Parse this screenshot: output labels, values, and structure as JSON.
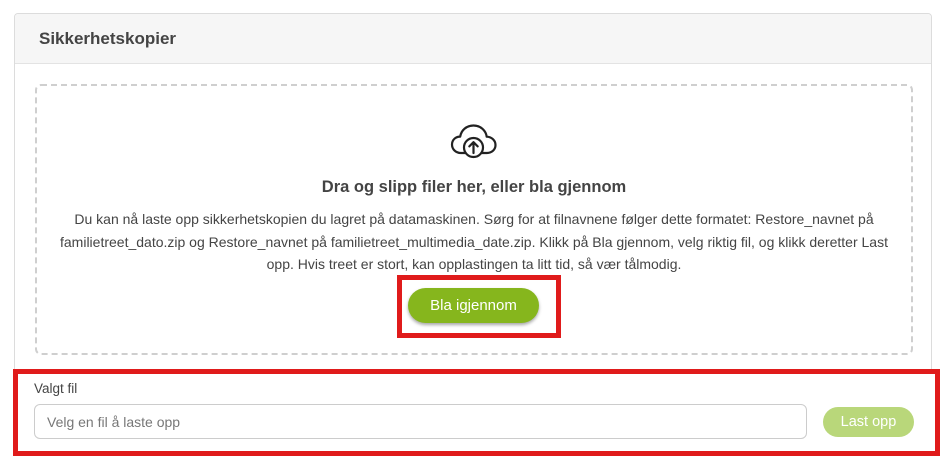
{
  "card": {
    "title": "Sikkerhetskopier"
  },
  "dropzone": {
    "icon": "cloud-upload-icon",
    "title": "Dra og slipp filer her, eller bla gjennom",
    "description": "Du kan nå laste opp sikkerhetskopien du lagret på datamaskinen. Sørg for at filnavnene følger dette formatet: Restore_navnet på familietreet_dato.zip og Restore_navnet på familietreet_multimedia_date.zip. Klikk på Bla gjennom, velg riktig fil, og klikk deretter Last opp. Hvis treet er stort, kan opplastingen ta litt tid, så vær tålmodig.",
    "browse_label": "Bla igjennom"
  },
  "file": {
    "label": "Valgt fil",
    "value": "",
    "placeholder": "Velg en fil å laste opp",
    "upload_label": "Last opp"
  },
  "colors": {
    "accent": "#86b61d",
    "accent_disabled": "#b9d77a",
    "highlight": "#e01b1b"
  }
}
